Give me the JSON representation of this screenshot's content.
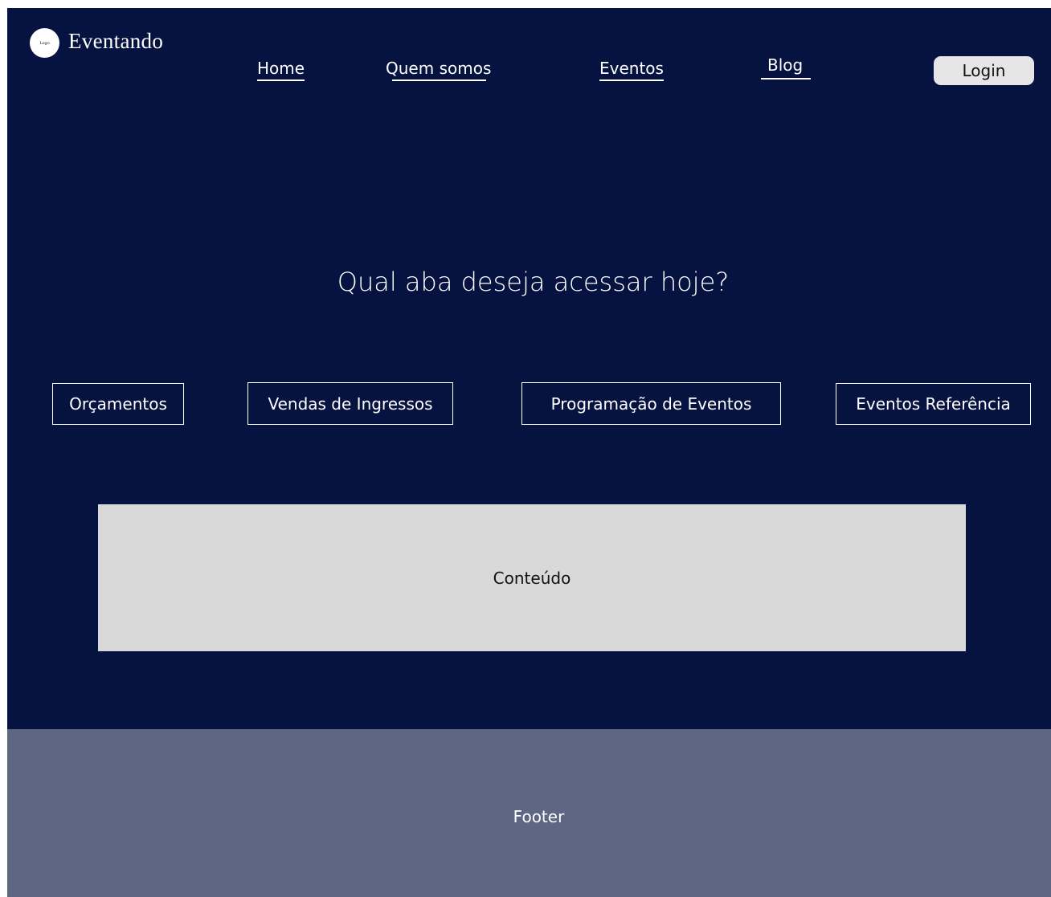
{
  "header": {
    "logo_text": "Logo",
    "brand": "Eventando",
    "nav": {
      "home": "Home",
      "quem_somos": "Quem somos",
      "eventos": "Eventos",
      "blog": "Blog"
    },
    "login": "Login"
  },
  "main": {
    "question": "Qual aba deseja acessar hoje?",
    "tabs": {
      "orcamentos": "Orçamentos",
      "vendas": "Vendas de Ingressos",
      "programacao": "Programação de Eventos",
      "referencia": "Eventos Referência"
    },
    "content_label": "Conteúdo"
  },
  "footer": {
    "label": "Footer"
  },
  "colors": {
    "background": "#061341",
    "footer": "#5d6683",
    "content": "#d9d9d9",
    "login_button": "#e6e6e6"
  }
}
